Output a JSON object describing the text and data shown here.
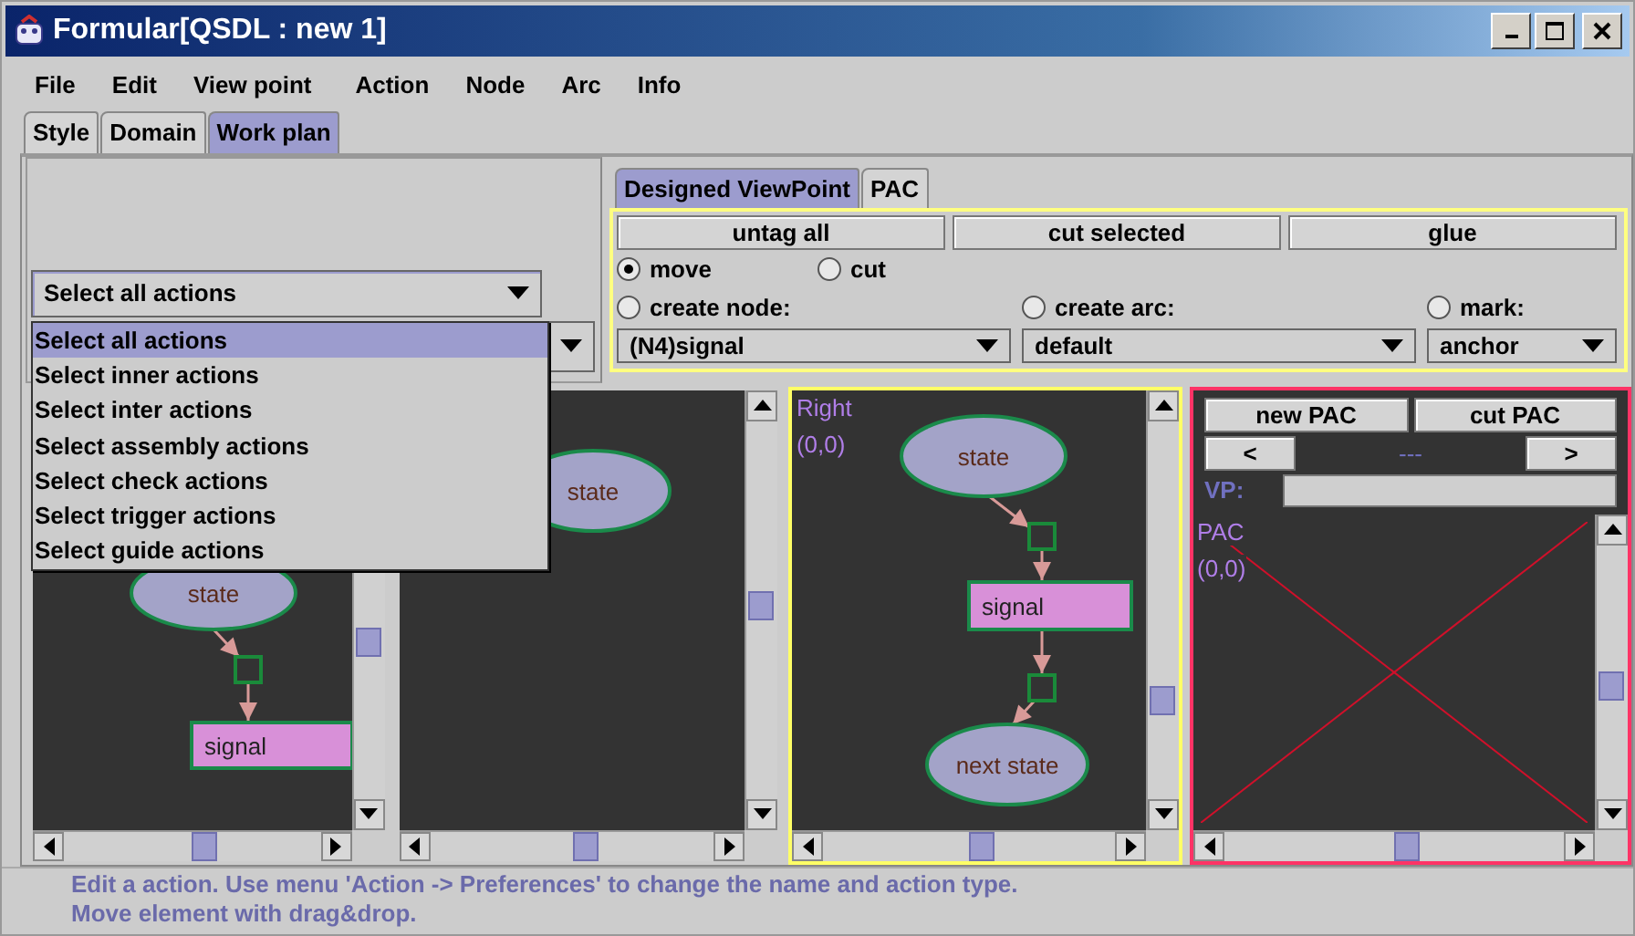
{
  "window": {
    "title": "Formular[QSDL : new 1]"
  },
  "menu": [
    "File",
    "Edit",
    "View point",
    "Action",
    "Node",
    "Arc",
    "Info"
  ],
  "tabs": [
    {
      "label": "Style",
      "selected": false
    },
    {
      "label": "Domain",
      "selected": false
    },
    {
      "label": "Work plan",
      "selected": true
    }
  ],
  "action_filter": {
    "value": "Select all actions",
    "expanded": true,
    "options": [
      {
        "label": "Select all actions",
        "selected": true
      },
      {
        "label": "Select inner actions",
        "selected": false
      },
      {
        "label": "Select inter actions",
        "selected": false
      },
      {
        "label": "Select assembly actions",
        "selected": false
      },
      {
        "label": "Select check actions",
        "selected": false
      },
      {
        "label": "Select trigger actions",
        "selected": false
      },
      {
        "label": "Select guide actions",
        "selected": false
      }
    ]
  },
  "viewpoint_tabs": [
    {
      "label": "Designed ViewPoint",
      "selected": true
    },
    {
      "label": "PAC",
      "selected": false
    }
  ],
  "tool_buttons": [
    "untag all",
    "cut selected",
    "glue"
  ],
  "modes": [
    {
      "label": "move",
      "selected": true
    },
    {
      "label": "cut",
      "selected": false
    },
    {
      "label": "create node:",
      "selected": false
    },
    {
      "label": "create arc:",
      "selected": false
    },
    {
      "label": "mark:",
      "selected": false
    }
  ],
  "selectors": [
    "(N4)signal",
    "default",
    "anchor"
  ],
  "canvases": [
    {
      "kind": "diagram",
      "nodes": [
        {
          "kind": "state",
          "text": "state"
        },
        {
          "kind": "signal",
          "text": "signal"
        }
      ]
    },
    {
      "kind": "diagram",
      "nodes": [
        {
          "kind": "state",
          "text": "state"
        }
      ]
    },
    {
      "kind": "diagram",
      "color": "#ffff66",
      "label": "Right",
      "coords": "(0,0)",
      "nodes": [
        {
          "kind": "state",
          "text": "state"
        },
        {
          "kind": "signal",
          "text": "signal"
        },
        {
          "kind": "state",
          "text": "next state"
        }
      ]
    },
    {
      "kind": "pac",
      "color": "#ff3366",
      "buttons": [
        "new PAC",
        "cut PAC"
      ],
      "prev": "<",
      "next": ">",
      "index": "---",
      "vp_label": "VP:",
      "label": "PAC",
      "coords": "(0,0)"
    }
  ],
  "status": [
    "Edit a action. Use menu 'Action -> Preferences' to change the name and action type.",
    "Move element with drag&drop."
  ]
}
